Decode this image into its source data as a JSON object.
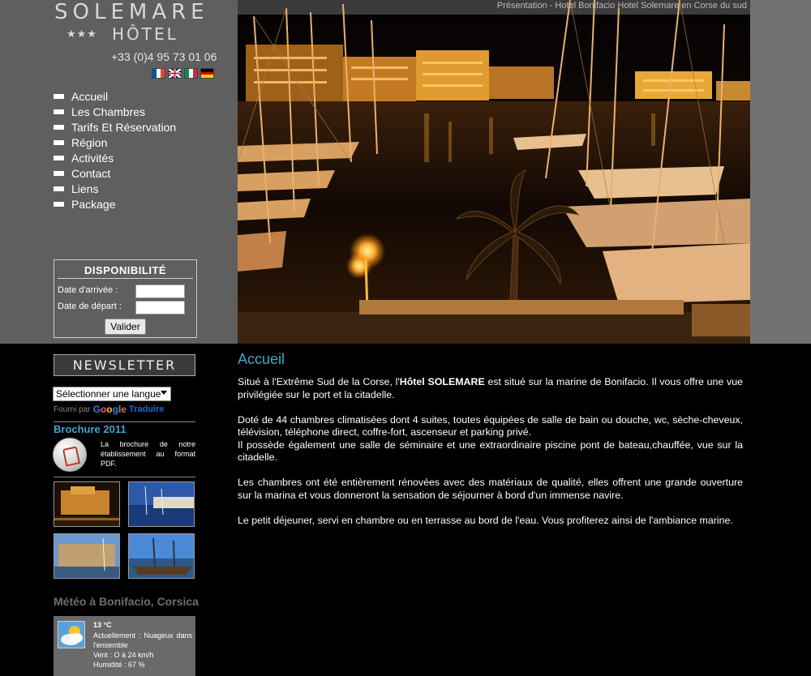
{
  "logo": {
    "name": "SOLEMARE",
    "stars": "★★★",
    "word": "HÔTEL"
  },
  "header": {
    "phone": "+33 (0)4 95 73 01 06",
    "caption": "Présentation - Hotel Bonifacio Hotel Solemare en Corse du sud"
  },
  "languages": [
    {
      "icon": "flag-fr-icon",
      "colors": [
        "#0055a4",
        "#ffffff",
        "#ef4135"
      ]
    },
    {
      "icon": "flag-gb-icon",
      "colors": [
        "#012169",
        "#c8102e",
        "#012169"
      ]
    },
    {
      "icon": "flag-it-icon",
      "colors": [
        "#009246",
        "#ffffff",
        "#ce2b37"
      ]
    },
    {
      "icon": "flag-de-icon",
      "colors": [
        "#000000",
        "#dd0000",
        "#ffce00"
      ]
    }
  ],
  "nav": [
    "Accueil",
    "Les Chambres",
    "Tarifs Et Réservation",
    "Région",
    "Activités",
    "Contact",
    "Liens",
    "Package"
  ],
  "booking": {
    "title": "DISPONIBILITÉ",
    "arrival_label": "Date d'arrivée :",
    "departure_label": "Date de départ :",
    "arrival_value": "",
    "departure_value": "",
    "submit": "Valider"
  },
  "newsletter": {
    "title": "NEWSLETTER",
    "language_select": "Sélectionner une langue",
    "powered_by": "Fourni par",
    "google": "Google",
    "translate": "Traduire"
  },
  "brochure": {
    "title": "Brochure 2011",
    "text": "La brochure de notre établissement au format PDF."
  },
  "weather": {
    "title": "Météo à Bonifacio, Corsica",
    "temperature": "13 °C",
    "current": "Actuellement : Nuageux dans l'ensemble",
    "wind": "Vent : O à 24 km/h",
    "humidity": "Humidité : 67 %"
  },
  "main": {
    "title": "Accueil",
    "p1_a": "Situé à l'Extrême Sud de la Corse, l'",
    "p1_bold": "Hôtel SOLEMARE",
    "p1_b": " est situé sur la marine de Bonifacio. Il vous offre une vue privilégiée sur le port et la citadelle.",
    "p2_a": "Doté de 44 chambres  climatisées dont 4 suites, toutes équipées de salle de bain ou douche, wc, sèche-cheveux, télévision, téléphone direct, coffre-fort, ascenseur et parking privé.",
    "p2_b": "Il possède également une salle de séminaire  et une extraordinaire piscine pont de bateau,chauffée, vue sur la citadelle.",
    "p3": "Les chambres ont été entièrement rénovées avec des matériaux de qualité, elles offrent une  grande ouverture sur la marina et vous donneront la sensation de séjourner à bord d'un immense navire.",
    "p4": "Le petit déjeuner, servi en chambre ou en terrasse au bord de l'eau. Vous profiterez ainsi de l'ambiance marine."
  },
  "colors": {
    "accent": "#3fa7c9",
    "panel": "#5f5f5f",
    "band": "#727272"
  }
}
